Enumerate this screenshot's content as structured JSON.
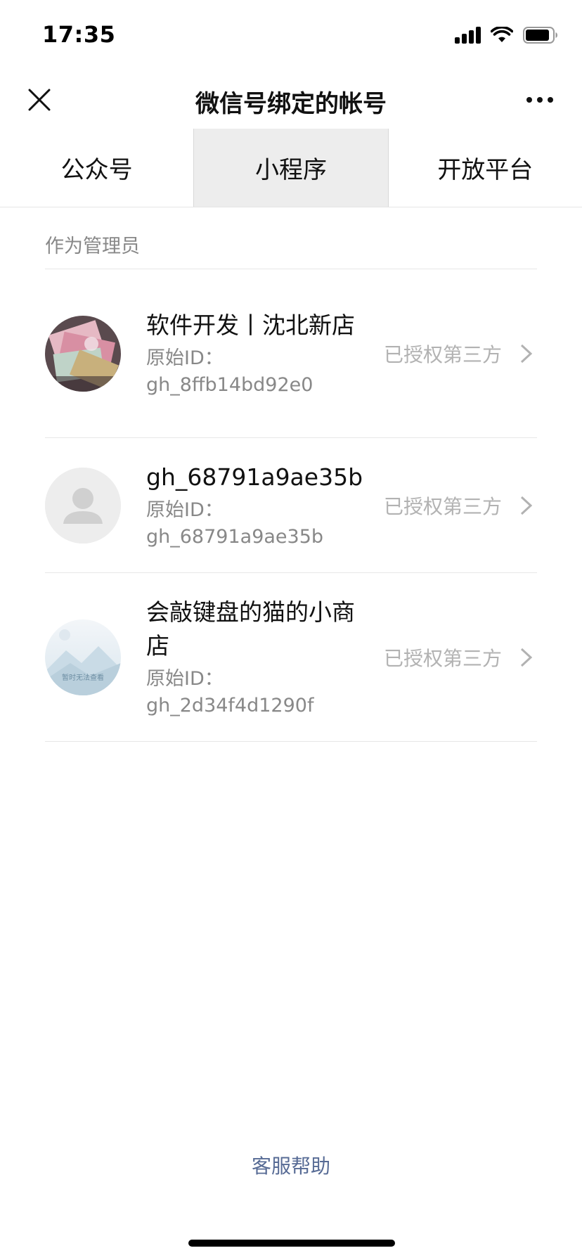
{
  "status_bar": {
    "time": "17:35"
  },
  "nav": {
    "title": "微信号绑定的帐号"
  },
  "tabs": [
    {
      "label": "公众号",
      "active": false
    },
    {
      "label": "小程序",
      "active": true
    },
    {
      "label": "开放平台",
      "active": false
    }
  ],
  "section": {
    "header": "作为管理员"
  },
  "accounts": [
    {
      "name": "软件开发丨沈北新店",
      "id_label": "原始ID：",
      "id": "gh_8ffb14bd92e0",
      "status": "已授权第三方",
      "avatar_icon": "money-photo-avatar"
    },
    {
      "name": "gh_68791a9ae35b",
      "id_label": "原始ID：",
      "id": "gh_68791a9ae35b",
      "status": "已授权第三方",
      "avatar_icon": "default-user-avatar"
    },
    {
      "name": "会敲键盘的猫的小商店",
      "id_label": "原始ID：",
      "id": "gh_2d34f4d1290f",
      "status": "已授权第三方",
      "avatar_icon": "image-unavailable-avatar",
      "avatar_text": "暂时无法查看"
    }
  ],
  "footer": {
    "help_label": "客服帮助"
  },
  "colors": {
    "link": "#576b95",
    "secondary_text": "#888888",
    "status_text": "#b2b2b2",
    "active_tab_bg": "#ededed"
  }
}
